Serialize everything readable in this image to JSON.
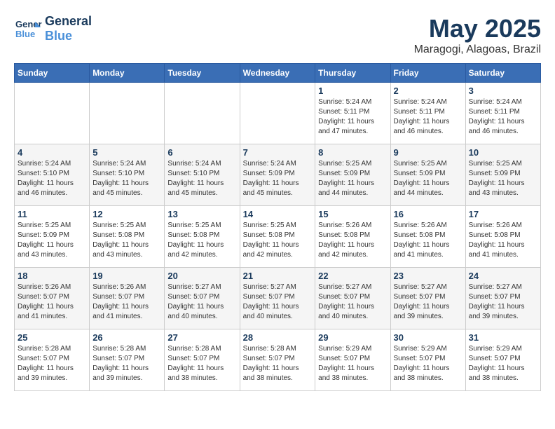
{
  "header": {
    "logo_line1": "General",
    "logo_line2": "Blue",
    "month": "May 2025",
    "location": "Maragogi, Alagoas, Brazil"
  },
  "weekdays": [
    "Sunday",
    "Monday",
    "Tuesday",
    "Wednesday",
    "Thursday",
    "Friday",
    "Saturday"
  ],
  "weeks": [
    [
      {
        "day": "",
        "info": ""
      },
      {
        "day": "",
        "info": ""
      },
      {
        "day": "",
        "info": ""
      },
      {
        "day": "",
        "info": ""
      },
      {
        "day": "1",
        "info": "Sunrise: 5:24 AM\nSunset: 5:11 PM\nDaylight: 11 hours\nand 47 minutes."
      },
      {
        "day": "2",
        "info": "Sunrise: 5:24 AM\nSunset: 5:11 PM\nDaylight: 11 hours\nand 46 minutes."
      },
      {
        "day": "3",
        "info": "Sunrise: 5:24 AM\nSunset: 5:11 PM\nDaylight: 11 hours\nand 46 minutes."
      }
    ],
    [
      {
        "day": "4",
        "info": "Sunrise: 5:24 AM\nSunset: 5:10 PM\nDaylight: 11 hours\nand 46 minutes."
      },
      {
        "day": "5",
        "info": "Sunrise: 5:24 AM\nSunset: 5:10 PM\nDaylight: 11 hours\nand 45 minutes."
      },
      {
        "day": "6",
        "info": "Sunrise: 5:24 AM\nSunset: 5:10 PM\nDaylight: 11 hours\nand 45 minutes."
      },
      {
        "day": "7",
        "info": "Sunrise: 5:24 AM\nSunset: 5:09 PM\nDaylight: 11 hours\nand 45 minutes."
      },
      {
        "day": "8",
        "info": "Sunrise: 5:25 AM\nSunset: 5:09 PM\nDaylight: 11 hours\nand 44 minutes."
      },
      {
        "day": "9",
        "info": "Sunrise: 5:25 AM\nSunset: 5:09 PM\nDaylight: 11 hours\nand 44 minutes."
      },
      {
        "day": "10",
        "info": "Sunrise: 5:25 AM\nSunset: 5:09 PM\nDaylight: 11 hours\nand 43 minutes."
      }
    ],
    [
      {
        "day": "11",
        "info": "Sunrise: 5:25 AM\nSunset: 5:09 PM\nDaylight: 11 hours\nand 43 minutes."
      },
      {
        "day": "12",
        "info": "Sunrise: 5:25 AM\nSunset: 5:08 PM\nDaylight: 11 hours\nand 43 minutes."
      },
      {
        "day": "13",
        "info": "Sunrise: 5:25 AM\nSunset: 5:08 PM\nDaylight: 11 hours\nand 42 minutes."
      },
      {
        "day": "14",
        "info": "Sunrise: 5:25 AM\nSunset: 5:08 PM\nDaylight: 11 hours\nand 42 minutes."
      },
      {
        "day": "15",
        "info": "Sunrise: 5:26 AM\nSunset: 5:08 PM\nDaylight: 11 hours\nand 42 minutes."
      },
      {
        "day": "16",
        "info": "Sunrise: 5:26 AM\nSunset: 5:08 PM\nDaylight: 11 hours\nand 41 minutes."
      },
      {
        "day": "17",
        "info": "Sunrise: 5:26 AM\nSunset: 5:08 PM\nDaylight: 11 hours\nand 41 minutes."
      }
    ],
    [
      {
        "day": "18",
        "info": "Sunrise: 5:26 AM\nSunset: 5:07 PM\nDaylight: 11 hours\nand 41 minutes."
      },
      {
        "day": "19",
        "info": "Sunrise: 5:26 AM\nSunset: 5:07 PM\nDaylight: 11 hours\nand 41 minutes."
      },
      {
        "day": "20",
        "info": "Sunrise: 5:27 AM\nSunset: 5:07 PM\nDaylight: 11 hours\nand 40 minutes."
      },
      {
        "day": "21",
        "info": "Sunrise: 5:27 AM\nSunset: 5:07 PM\nDaylight: 11 hours\nand 40 minutes."
      },
      {
        "day": "22",
        "info": "Sunrise: 5:27 AM\nSunset: 5:07 PM\nDaylight: 11 hours\nand 40 minutes."
      },
      {
        "day": "23",
        "info": "Sunrise: 5:27 AM\nSunset: 5:07 PM\nDaylight: 11 hours\nand 39 minutes."
      },
      {
        "day": "24",
        "info": "Sunrise: 5:27 AM\nSunset: 5:07 PM\nDaylight: 11 hours\nand 39 minutes."
      }
    ],
    [
      {
        "day": "25",
        "info": "Sunrise: 5:28 AM\nSunset: 5:07 PM\nDaylight: 11 hours\nand 39 minutes."
      },
      {
        "day": "26",
        "info": "Sunrise: 5:28 AM\nSunset: 5:07 PM\nDaylight: 11 hours\nand 39 minutes."
      },
      {
        "day": "27",
        "info": "Sunrise: 5:28 AM\nSunset: 5:07 PM\nDaylight: 11 hours\nand 38 minutes."
      },
      {
        "day": "28",
        "info": "Sunrise: 5:28 AM\nSunset: 5:07 PM\nDaylight: 11 hours\nand 38 minutes."
      },
      {
        "day": "29",
        "info": "Sunrise: 5:29 AM\nSunset: 5:07 PM\nDaylight: 11 hours\nand 38 minutes."
      },
      {
        "day": "30",
        "info": "Sunrise: 5:29 AM\nSunset: 5:07 PM\nDaylight: 11 hours\nand 38 minutes."
      },
      {
        "day": "31",
        "info": "Sunrise: 5:29 AM\nSunset: 5:07 PM\nDaylight: 11 hours\nand 38 minutes."
      }
    ]
  ]
}
